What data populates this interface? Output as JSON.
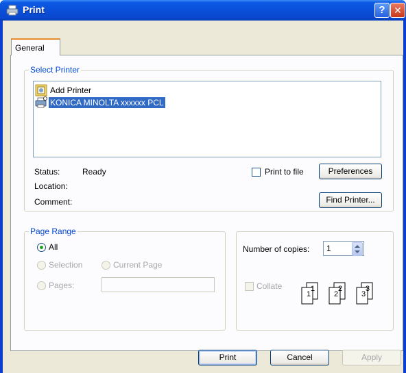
{
  "window": {
    "title": "Print",
    "help_label": "?",
    "close_label": "✕"
  },
  "tabs": [
    {
      "label": "General"
    }
  ],
  "select_printer": {
    "group_label": "Select Printer",
    "printers": [
      {
        "label": "Add Printer",
        "icon": "add-printer-icon",
        "selected": false
      },
      {
        "label": "KONICA MINOLTA xxxxxx PCL",
        "icon": "printer-icon",
        "selected": true
      }
    ],
    "status_label": "Status:",
    "status_value": "Ready",
    "location_label": "Location:",
    "location_value": "",
    "comment_label": "Comment:",
    "comment_value": "",
    "print_to_file_label": "Print to file",
    "print_to_file_checked": false,
    "preferences_label": "Preferences",
    "find_printer_label": "Find Printer..."
  },
  "page_range": {
    "group_label": "Page Range",
    "all_label": "All",
    "all_selected": true,
    "selection_label": "Selection",
    "current_page_label": "Current Page",
    "pages_label": "Pages:",
    "pages_value": ""
  },
  "copies": {
    "number_label": "Number of copies:",
    "number_value": "1",
    "collate_label": "Collate",
    "collate_checked": false,
    "collate_pages": [
      "1",
      "1",
      "2",
      "2",
      "3",
      "3"
    ]
  },
  "footer": {
    "print_label": "Print",
    "cancel_label": "Cancel",
    "apply_label": "Apply"
  },
  "colors": {
    "title_bar": "#0a4fd8",
    "dialog_bg": "#ece9d8",
    "group_label": "#0046d5",
    "selection": "#316ac5"
  }
}
